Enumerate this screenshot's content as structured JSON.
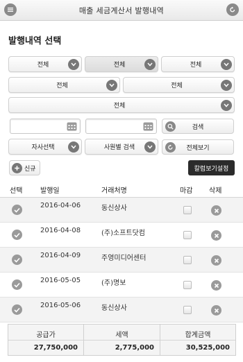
{
  "header": {
    "title": "매출 세금계산서 발행내역",
    "left_icon": "menu-list-icon",
    "right_icon": "back-arrow-icon"
  },
  "section_title": "발행내역 선택",
  "filters": {
    "row1": [
      "전체",
      "전체",
      "전체"
    ],
    "row2": [
      "전체",
      "전체"
    ],
    "row3": "전체",
    "search_label": "검색",
    "company_select": "자사선택",
    "employee_select": "사원별 검색",
    "view_all_label": "전체보기",
    "new_label": "신규",
    "column_settings_label": "칼럼보기설정"
  },
  "table": {
    "headers": [
      "선택",
      "발행일",
      "거래처명",
      "마감",
      "삭제"
    ],
    "rows": [
      {
        "date": "2016-04-06",
        "name": "동신상사"
      },
      {
        "date": "2016-04-08",
        "name": "(주)소프트닷컴"
      },
      {
        "date": "2016-04-09",
        "name": "주영미디어센터"
      },
      {
        "date": "2016-05-05",
        "name": "(주)명보"
      },
      {
        "date": "2016-05-06",
        "name": "동신상사"
      }
    ]
  },
  "totals": {
    "supply_label": "공급가",
    "supply_value": "27,750,000",
    "tax_label": "세액",
    "tax_value": "2,775,000",
    "sum_label": "합계금액",
    "sum_value": "30,525,000"
  }
}
